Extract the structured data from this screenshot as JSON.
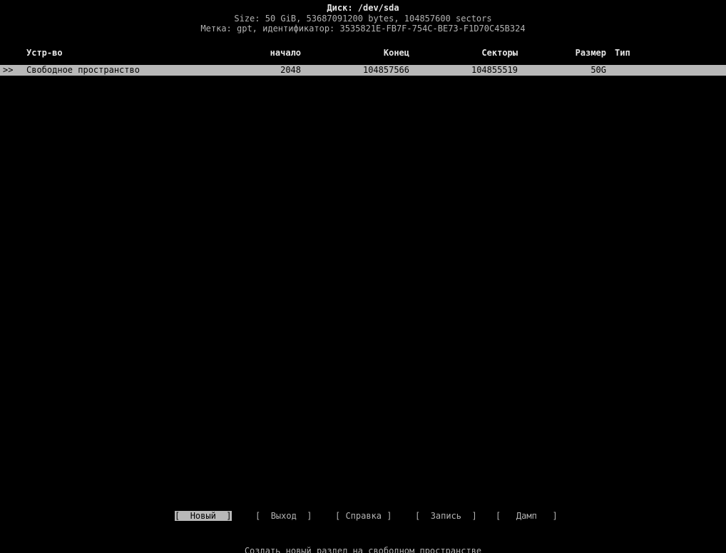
{
  "header": {
    "title": "Диск: /dev/sda",
    "size_line": "Size: 50 GiB, 53687091200 bytes, 104857600 sectors",
    "label_line": "Метка: gpt, идентификатор: 3535821E-FB7F-754C-BE73-F1D70C45B324"
  },
  "table": {
    "columns": {
      "device": "Устр-во",
      "start": "начало",
      "end": "Конец",
      "sectors": "Секторы",
      "size": "Размер",
      "type": "Тип"
    },
    "rows": [
      {
        "pointer": ">>",
        "device": "Свободное пространство",
        "start": "2048",
        "end": "104857566",
        "sectors": "104855519",
        "size": "50G",
        "type": ""
      }
    ]
  },
  "menu": {
    "items": [
      {
        "label": "Новый",
        "selected": true
      },
      {
        "label": "Выход",
        "selected": false
      },
      {
        "label": "Справка",
        "selected": false
      },
      {
        "label": "Запись",
        "selected": false
      },
      {
        "label": "Дамп",
        "selected": false
      }
    ]
  },
  "hint": "Создать новый раздел на свободном пространстве",
  "colors": {
    "background": "#000000",
    "text": "#b2b2b2",
    "highlight_bg": "#b8b8b8",
    "highlight_fg": "#000000"
  }
}
